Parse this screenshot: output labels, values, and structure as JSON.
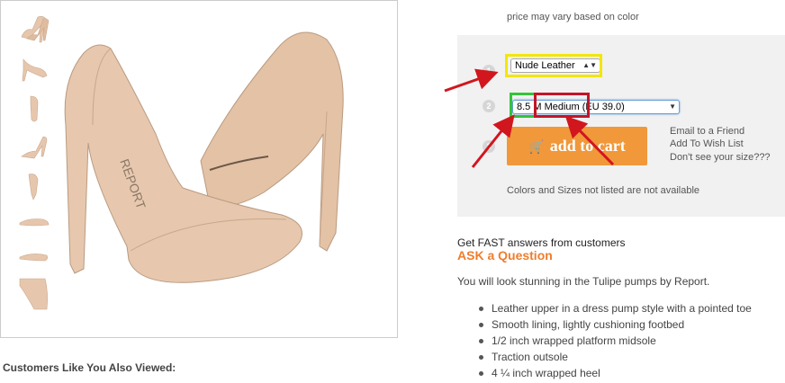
{
  "product": {
    "price_note": "price may vary based on color",
    "color_select": {
      "value": "Nude Leather"
    },
    "size_select": {
      "value": "8.5 M Medium (EU 39.0)"
    },
    "step_numbers": [
      "1",
      "2",
      "3"
    ],
    "add_to_cart_label": "add to cart",
    "side_links": [
      "Email to a Friend",
      "Add To Wish List",
      "Don't see your size???"
    ],
    "not_listed_note": "Colors and Sizes not listed are not available"
  },
  "qa": {
    "fast_answers": "Get FAST answers from customers",
    "ask_question": "ASK a Question"
  },
  "description": {
    "intro": "You will look stunning in the Tulipe pumps by Report.",
    "features": [
      "Leather upper in a dress pump style with a pointed toe",
      "Smooth lining, lightly cushioning footbed",
      "1/2 inch wrapped platform midsole",
      "Traction outsole",
      "4 ¼ inch wrapped heel"
    ]
  },
  "recommendations": {
    "heading": "Customers Like You Also Viewed:"
  },
  "colors": {
    "highlight_yellow": "#f3e60a",
    "highlight_green": "#33c43a",
    "highlight_red": "#c41428",
    "arrow": "#d1161e",
    "cart_button": "#f0983a",
    "ask_link": "#ef7d2c",
    "shoe": "#e6c7ad"
  },
  "icons": [
    "cart-icon",
    "arrow-annotation",
    "shoe-image"
  ]
}
